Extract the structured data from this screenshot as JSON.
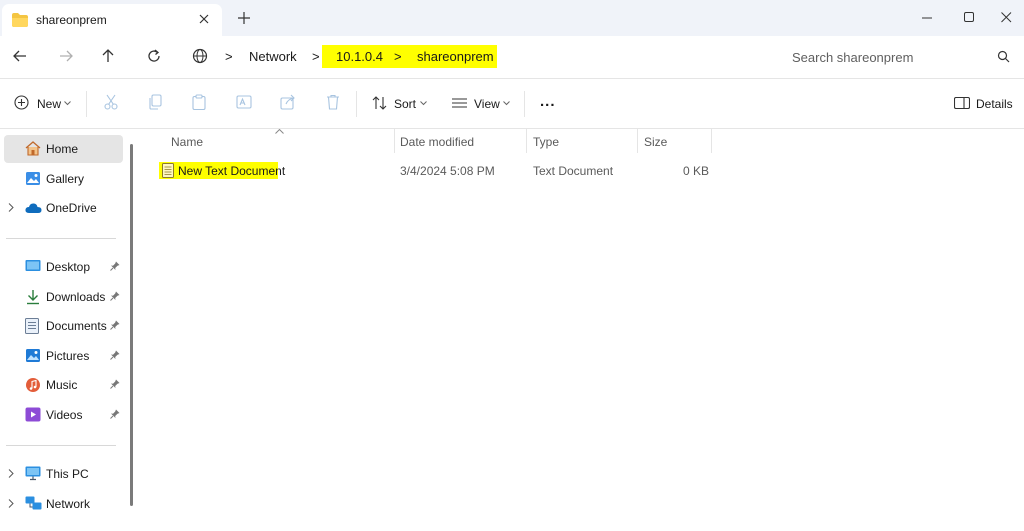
{
  "tab": {
    "title": "shareonprem",
    "folder_icon": "folder-icon"
  },
  "window": {
    "minimize_glyph": "—",
    "maximize_glyph": "☐",
    "close_glyph": "✕",
    "new_tab_glyph": "+"
  },
  "address": {
    "breadcrumbs": [
      "Network",
      "10.1.0.4",
      "shareonprem"
    ],
    "separator": ">",
    "highlight_color": "#ffff00"
  },
  "search": {
    "placeholder": "Search shareonprem"
  },
  "toolbar": {
    "new_label": "New",
    "sort_label": "Sort",
    "view_label": "View",
    "more_label": "...",
    "details_label": "Details"
  },
  "sidebar": {
    "items": [
      {
        "label": "Home",
        "icon": "home-icon",
        "selected": true
      },
      {
        "label": "Gallery",
        "icon": "gallery-icon"
      },
      {
        "label": "OneDrive",
        "icon": "cloud-icon"
      },
      {
        "label": "Desktop",
        "icon": "desktop-icon",
        "pinned": true
      },
      {
        "label": "Downloads",
        "icon": "download-icon",
        "pinned": true
      },
      {
        "label": "Documents",
        "icon": "documents-icon",
        "pinned": true
      },
      {
        "label": "Pictures",
        "icon": "pictures-icon",
        "pinned": true
      },
      {
        "label": "Music",
        "icon": "music-icon",
        "pinned": true
      },
      {
        "label": "Videos",
        "icon": "videos-icon",
        "pinned": true
      },
      {
        "label": "This PC",
        "icon": "computer-icon"
      },
      {
        "label": "Network",
        "icon": "network-icon"
      }
    ]
  },
  "columns": [
    "Name",
    "Date modified",
    "Type",
    "Size"
  ],
  "files": [
    {
      "name": "New Text Document",
      "date_modified": "3/4/2024 5:08 PM",
      "type": "Text Document",
      "size": "0 KB",
      "highlighted": true
    }
  ],
  "colors": {
    "accent": "#0067c0",
    "selected_bg": "#e5e5e5",
    "titlebar_bg": "#f0f3f9"
  }
}
